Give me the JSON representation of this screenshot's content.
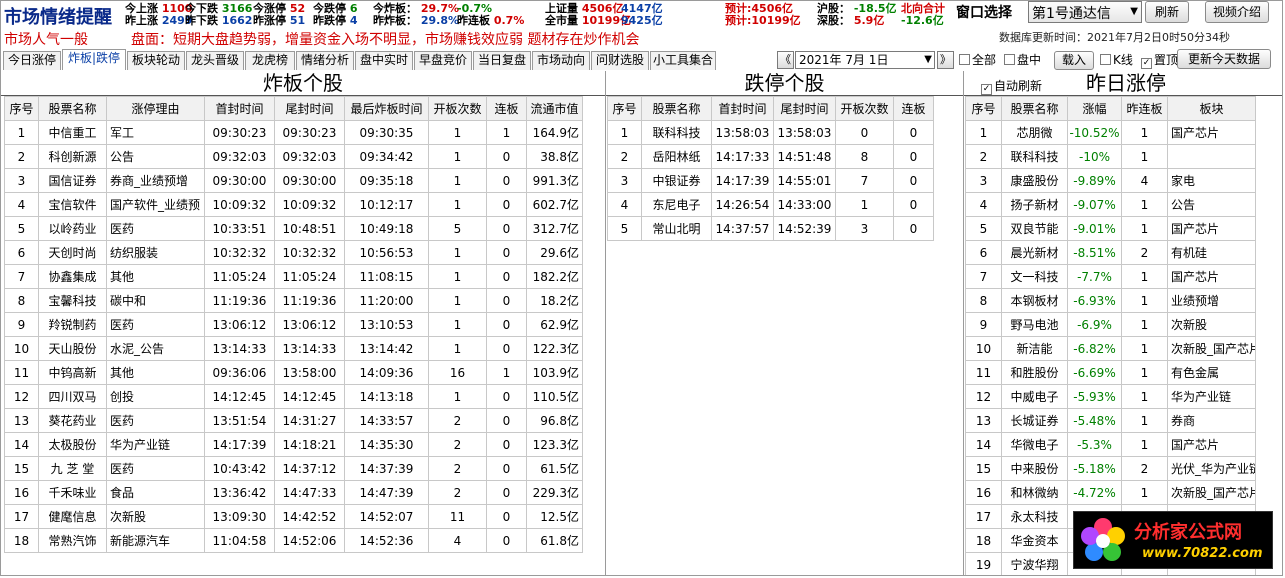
{
  "header": {
    "app_title": "市场情绪提醒",
    "mood": "市场人气一般",
    "remark": "盘面：短期大盘趋势弱，增量资金入场不明显，市场赚钱效应弱   题材存在炒作机会",
    "stats_row1": [
      {
        "label": "今上涨",
        "value": "1100",
        "color": "red"
      },
      {
        "label": "今下跌",
        "value": "3166",
        "color": "grn"
      },
      {
        "label": "今涨停",
        "value": "52",
        "color": "red"
      },
      {
        "label": "今跌停",
        "value": "6",
        "color": "grn"
      },
      {
        "label": "今炸板：",
        "value": "29.7%",
        "color": "red"
      },
      {
        "label": "",
        "value": "-0.7%",
        "color": "grn"
      },
      {
        "label": "上证量",
        "value": "4506亿",
        "color": "red"
      },
      {
        "label": "",
        "value": "4147亿",
        "color": "blue"
      },
      {
        "label": "预计:4506亿",
        "value": "",
        "color": "red"
      },
      {
        "label": "沪股：",
        "value": "-18.5亿",
        "color": "grn"
      },
      {
        "label": "北向合计",
        "value": "",
        "color": "red"
      }
    ],
    "stats_row2": [
      {
        "label": "昨上涨",
        "value": "2499",
        "color": "blue"
      },
      {
        "label": "昨下跌",
        "value": "1662",
        "color": "blue"
      },
      {
        "label": "昨涨停",
        "value": "51",
        "color": "blue"
      },
      {
        "label": "昨跌停",
        "value": "4",
        "color": "blue"
      },
      {
        "label": "昨炸板：",
        "value": "29.8%",
        "color": "blue"
      },
      {
        "label": "昨连板",
        "value": "0.7%",
        "color": "red"
      },
      {
        "label": "全市量",
        "value": "10199亿",
        "color": "red"
      },
      {
        "label": "",
        "value": "9425亿",
        "color": "blue"
      },
      {
        "label": "预计:10199亿",
        "value": "",
        "color": "red"
      },
      {
        "label": "深股：",
        "value": "5.9亿",
        "color": "red"
      },
      {
        "label": "",
        "value": "-12.6亿",
        "color": "grn"
      }
    ],
    "window_select_label": "窗口选择",
    "channel_value": "第1号通达信",
    "refresh_label": "刷新",
    "video_label": "视频介绍",
    "db_update_time": "数据库更新时间：2021年7月2日0时50分34秒"
  },
  "tabs": [
    "今日涨停",
    "炸板|跌停",
    "板块轮动",
    "龙头晋级",
    "龙虎榜",
    "情绪分析",
    "盘中实时",
    "早盘竞价",
    "当日复盘",
    "市场动向",
    "问财选股",
    "小工具集合"
  ],
  "active_tab": 1,
  "controls": {
    "date_value": "2021年 7月 1日",
    "prev_icon": "《",
    "next_icon": "》",
    "all_label": "全部",
    "intraday_label": "盘中",
    "load_label": "载入",
    "kline_label": "K线",
    "pin_label": "置顶",
    "update_label": "更新今天数据",
    "all_checked": false,
    "intraday_checked": false,
    "kline_checked": false,
    "pin_checked": true
  },
  "panels": {
    "blast": {
      "title": "炸板个股",
      "columns": [
        "序号",
        "股票名称",
        "涨停理由",
        "首封时间",
        "尾封时间",
        "最后炸板时间",
        "开板次数",
        "连板",
        "流通市值"
      ],
      "rows": [
        [
          "1",
          "中信重工",
          "军工",
          "09:30:23",
          "09:30:23",
          "09:30:35",
          "1",
          "1",
          "164.9亿"
        ],
        [
          "2",
          "科创新源",
          "公告",
          "09:32:03",
          "09:32:03",
          "09:34:42",
          "1",
          "0",
          "38.8亿"
        ],
        [
          "3",
          "国信证券",
          "券商_业绩预增",
          "09:30:00",
          "09:30:00",
          "09:35:18",
          "1",
          "0",
          "991.3亿"
        ],
        [
          "4",
          "宝信软件",
          "国产软件_业绩预",
          "10:09:32",
          "10:09:32",
          "10:12:17",
          "1",
          "0",
          "602.7亿"
        ],
        [
          "5",
          "以岭药业",
          "医药",
          "10:33:51",
          "10:48:51",
          "10:49:18",
          "5",
          "0",
          "312.7亿"
        ],
        [
          "6",
          "天创时尚",
          "纺织服装",
          "10:32:32",
          "10:32:32",
          "10:56:53",
          "1",
          "0",
          "29.6亿"
        ],
        [
          "7",
          "协鑫集成",
          "其他",
          "11:05:24",
          "11:05:24",
          "11:08:15",
          "1",
          "0",
          "182.2亿"
        ],
        [
          "8",
          "宝馨科技",
          "碳中和",
          "11:19:36",
          "11:19:36",
          "11:20:00",
          "1",
          "0",
          "18.2亿"
        ],
        [
          "9",
          "羚锐制药",
          "医药",
          "13:06:12",
          "13:06:12",
          "13:10:53",
          "1",
          "0",
          "62.9亿"
        ],
        [
          "10",
          "天山股份",
          "水泥_公告",
          "13:14:33",
          "13:14:33",
          "13:14:42",
          "1",
          "0",
          "122.3亿"
        ],
        [
          "11",
          "中钨高新",
          "其他",
          "09:36:06",
          "13:58:00",
          "14:09:36",
          "16",
          "1",
          "103.9亿"
        ],
        [
          "12",
          "四川双马",
          "创投",
          "14:12:45",
          "14:12:45",
          "14:13:18",
          "1",
          "0",
          "110.5亿"
        ],
        [
          "13",
          "葵花药业",
          "医药",
          "13:51:54",
          "14:31:27",
          "14:33:57",
          "2",
          "0",
          "96.8亿"
        ],
        [
          "14",
          "太极股份",
          "华为产业链",
          "14:17:39",
          "14:18:21",
          "14:35:30",
          "2",
          "0",
          "123.3亿"
        ],
        [
          "15",
          "九 芝 堂",
          "医药",
          "10:43:42",
          "14:37:12",
          "14:37:39",
          "2",
          "0",
          "61.5亿"
        ],
        [
          "16",
          "千禾味业",
          "食品",
          "13:36:42",
          "14:47:33",
          "14:47:39",
          "2",
          "0",
          "229.3亿"
        ],
        [
          "17",
          "健麾信息",
          "次新股",
          "13:09:30",
          "14:42:52",
          "14:52:07",
          "11",
          "0",
          "12.5亿"
        ],
        [
          "18",
          "常熟汽饰",
          "新能源汽车",
          "11:04:58",
          "14:52:06",
          "14:52:36",
          "4",
          "0",
          "61.8亿"
        ]
      ]
    },
    "limitdown": {
      "title": "跌停个股",
      "columns": [
        "序号",
        "股票名称",
        "首封时间",
        "尾封时间",
        "开板次数",
        "连板"
      ],
      "rows": [
        [
          "1",
          "联科科技",
          "13:58:03",
          "13:58:03",
          "0",
          "0"
        ],
        [
          "2",
          "岳阳林纸",
          "14:17:33",
          "14:51:48",
          "8",
          "0"
        ],
        [
          "3",
          "中银证券",
          "14:17:39",
          "14:55:01",
          "7",
          "0"
        ],
        [
          "4",
          "东尼电子",
          "14:26:54",
          "14:33:00",
          "1",
          "0"
        ],
        [
          "5",
          "常山北明",
          "14:37:57",
          "14:52:39",
          "3",
          "0"
        ]
      ]
    },
    "yesterday": {
      "title": "昨日涨停",
      "auto_refresh_label": "自动刷新",
      "auto_refresh_checked": true,
      "columns": [
        "序号",
        "股票名称",
        "涨幅",
        "昨连板",
        "板块"
      ],
      "rows": [
        [
          "1",
          "芯朋微",
          "-10.52%",
          "1",
          "国产芯片"
        ],
        [
          "2",
          "联科科技",
          "-10%",
          "1",
          ""
        ],
        [
          "3",
          "康盛股份",
          "-9.89%",
          "4",
          "家电"
        ],
        [
          "4",
          "扬子新材",
          "-9.07%",
          "1",
          "公告"
        ],
        [
          "5",
          "双良节能",
          "-9.01%",
          "1",
          "国产芯片"
        ],
        [
          "6",
          "晨光新材",
          "-8.51%",
          "2",
          "有机硅"
        ],
        [
          "7",
          "文一科技",
          "-7.7%",
          "1",
          "国产芯片"
        ],
        [
          "8",
          "本钢板材",
          "-6.93%",
          "1",
          "业绩预增"
        ],
        [
          "9",
          "野马电池",
          "-6.9%",
          "1",
          "次新股"
        ],
        [
          "10",
          "新洁能",
          "-6.82%",
          "1",
          "次新股_国产芯片"
        ],
        [
          "11",
          "和胜股份",
          "-6.69%",
          "1",
          "有色金属"
        ],
        [
          "12",
          "中威电子",
          "-5.93%",
          "1",
          "华为产业链"
        ],
        [
          "13",
          "长城证券",
          "-5.48%",
          "1",
          "券商"
        ],
        [
          "14",
          "华微电子",
          "-5.3%",
          "1",
          "国产芯片"
        ],
        [
          "15",
          "中来股份",
          "-5.18%",
          "2",
          "光伏_华为产业链"
        ],
        [
          "16",
          "和林微纳",
          "-4.72%",
          "1",
          "次新股_国产芯片"
        ],
        [
          "17",
          "永太科技",
          "",
          "",
          ""
        ],
        [
          "18",
          "华金资本",
          "",
          "",
          ""
        ],
        [
          "19",
          "宁波华翔",
          "",
          "",
          ""
        ]
      ]
    }
  },
  "logo": {
    "name": "分析家公式网",
    "url": "www.70822.com",
    "brand_red": "#ff2e2e",
    "brand_yellow": "#ffd000"
  }
}
